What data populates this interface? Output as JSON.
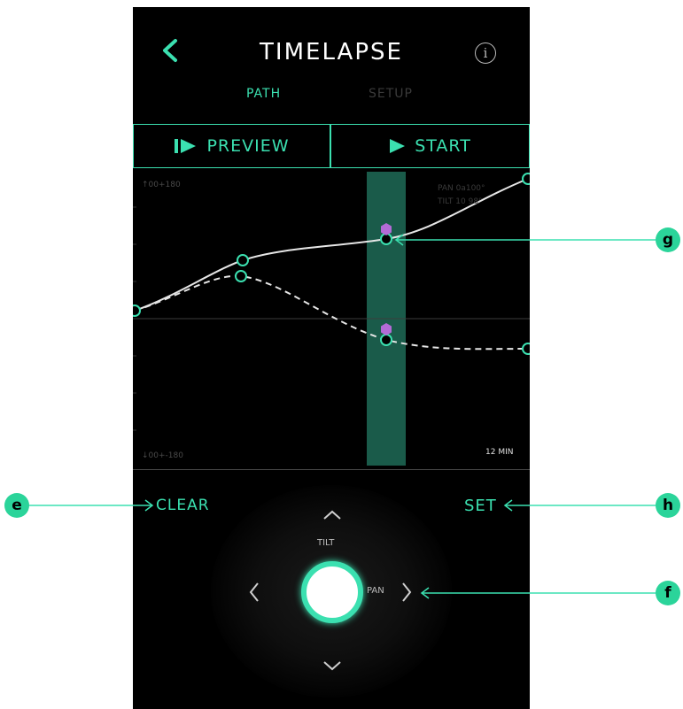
{
  "header": {
    "title": "TIMELAPSE",
    "info_icon": "i"
  },
  "tabs": [
    {
      "label": "PATH",
      "active": true
    },
    {
      "label": "SETUP",
      "active": false
    }
  ],
  "buttons": {
    "preview": "PREVIEW",
    "start": "START"
  },
  "graph": {
    "top_label": "↑00+180",
    "bottom_label": "↓00+-180",
    "readout_pan": "PAN 0a100°",
    "readout_tilt": "TILT 10 98°",
    "duration": "12 MIN"
  },
  "controls": {
    "clear": "CLEAR",
    "set": "SET",
    "tilt": "TILT",
    "pan": "PAN"
  },
  "callouts": {
    "e": "e",
    "f": "f",
    "g": "g",
    "h": "h"
  },
  "colors": {
    "accent": "#3be0b0",
    "callout": "#2bd49a",
    "marker": "#b36bd6",
    "background": "#000000"
  }
}
